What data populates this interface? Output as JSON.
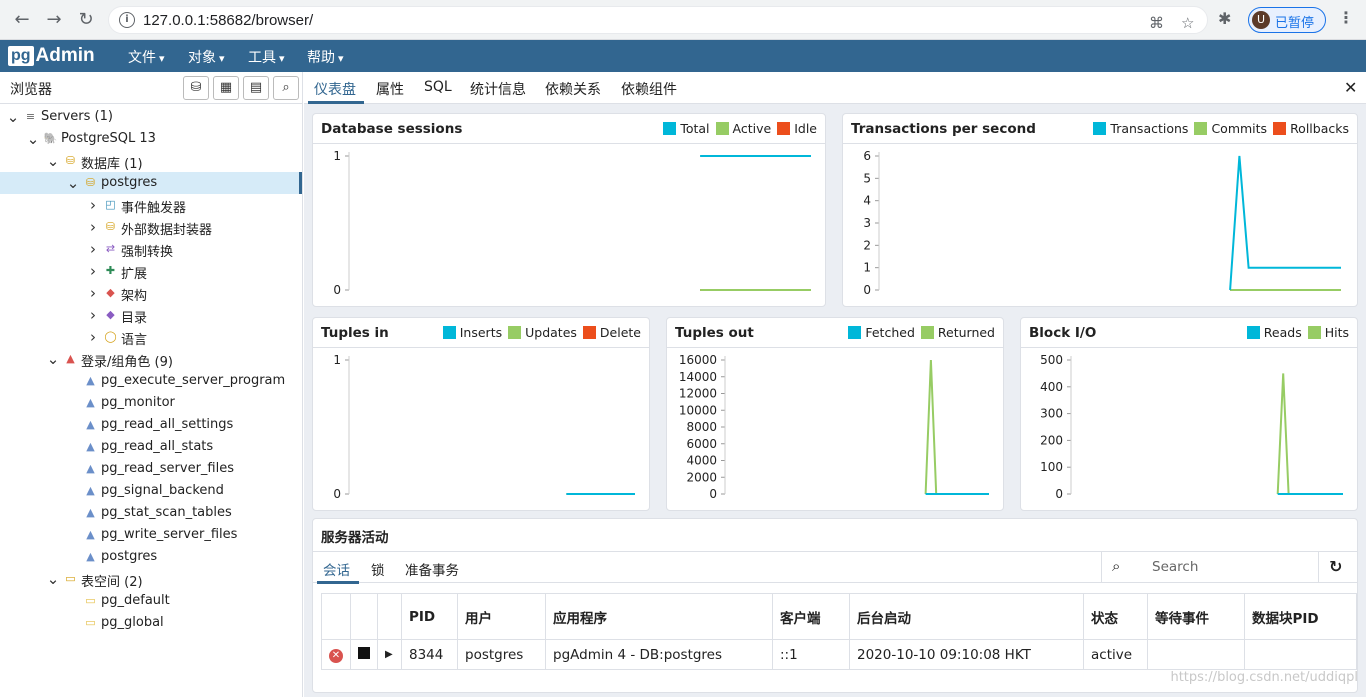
{
  "browser": {
    "url": "127.0.0.1:58682/browser/",
    "profile_initial": "U",
    "profile_label": "已暂停"
  },
  "navbar": {
    "logo_pg": "pg",
    "logo_admin": "Admin",
    "menus": [
      "文件",
      "对象",
      "工具",
      "帮助"
    ]
  },
  "left_panel": {
    "title": "浏览器",
    "tree": [
      {
        "label": "Servers (1)"
      },
      {
        "label": "PostgreSQL 13"
      },
      {
        "label": "数据库 (1)"
      },
      {
        "label": "postgres"
      },
      {
        "label": "事件触发器"
      },
      {
        "label": "外部数据封装器"
      },
      {
        "label": "强制转换"
      },
      {
        "label": "扩展"
      },
      {
        "label": "架构"
      },
      {
        "label": "目录"
      },
      {
        "label": "语言"
      },
      {
        "label": "登录/组角色 (9)"
      },
      {
        "label": "pg_execute_server_program"
      },
      {
        "label": "pg_monitor"
      },
      {
        "label": "pg_read_all_settings"
      },
      {
        "label": "pg_read_all_stats"
      },
      {
        "label": "pg_read_server_files"
      },
      {
        "label": "pg_signal_backend"
      },
      {
        "label": "pg_stat_scan_tables"
      },
      {
        "label": "pg_write_server_files"
      },
      {
        "label": "postgres"
      },
      {
        "label": "表空间 (2)"
      },
      {
        "label": "pg_default"
      },
      {
        "label": "pg_global"
      }
    ]
  },
  "tabs": [
    "仪表盘",
    "属性",
    "SQL",
    "统计信息",
    "依赖关系",
    "依赖组件"
  ],
  "colors": {
    "blue": "#00b7d9",
    "green": "#97cc64",
    "red": "#ec4e1c",
    "brand": "#326690"
  },
  "chart_data": [
    {
      "type": "line",
      "title": "Database sessions",
      "series": [
        {
          "name": "Total",
          "values": [
            1,
            1
          ]
        },
        {
          "name": "Active",
          "values": [
            0,
            0
          ]
        },
        {
          "name": "Idle",
          "values": [
            0,
            0
          ]
        }
      ],
      "yticks": [
        "1",
        "0"
      ],
      "ylim": [
        0,
        1
      ]
    },
    {
      "type": "line",
      "title": "Transactions per second",
      "series": [
        {
          "name": "Transactions",
          "values": [
            0,
            6,
            1,
            1,
            1
          ]
        },
        {
          "name": "Commits",
          "values": [
            0,
            0,
            0,
            0,
            0
          ]
        },
        {
          "name": "Rollbacks",
          "values": [
            0,
            0,
            0,
            0,
            0
          ]
        }
      ],
      "yticks": [
        "6",
        "5",
        "4",
        "3",
        "2",
        "1",
        "0"
      ],
      "ylim": [
        0,
        6
      ]
    },
    {
      "type": "line",
      "title": "Tuples in",
      "series": [
        {
          "name": "Inserts",
          "values": [
            0,
            0
          ]
        },
        {
          "name": "Updates",
          "values": [
            0,
            0
          ]
        },
        {
          "name": "Delete",
          "values": [
            0,
            0
          ]
        }
      ],
      "yticks": [
        "1",
        "0"
      ],
      "ylim": [
        0,
        1
      ]
    },
    {
      "type": "line",
      "title": "Tuples out",
      "series": [
        {
          "name": "Fetched",
          "values": [
            0,
            0,
            0,
            0
          ]
        },
        {
          "name": "Returned",
          "values": [
            0,
            16000,
            0,
            0
          ]
        }
      ],
      "yticks": [
        "16000",
        "14000",
        "12000",
        "10000",
        "8000",
        "6000",
        "4000",
        "2000",
        "0"
      ],
      "ylim": [
        0,
        16000
      ]
    },
    {
      "type": "line",
      "title": "Block I/O",
      "series": [
        {
          "name": "Reads",
          "values": [
            0,
            0,
            0,
            0
          ]
        },
        {
          "name": "Hits",
          "values": [
            0,
            450,
            0,
            0
          ]
        }
      ],
      "yticks": [
        "500",
        "400",
        "300",
        "200",
        "100",
        "0"
      ],
      "ylim": [
        0,
        500
      ]
    }
  ],
  "activity": {
    "title": "服务器活动",
    "tabs": [
      "会话",
      "锁",
      "准备事务"
    ],
    "search_placeholder": "Search",
    "columns": [
      "PID",
      "用户",
      "应用程序",
      "客户端",
      "后台启动",
      "状态",
      "等待事件",
      "数据块PID"
    ],
    "rows": [
      {
        "pid": "8344",
        "user": "postgres",
        "app": "pgAdmin 4 - DB:postgres",
        "client": "::1",
        "start": "2020-10-10 09:10:08 HKT",
        "state": "active",
        "wait": "",
        "blocking": ""
      }
    ]
  },
  "watermark": "https://blog.csdn.net/uddiqpl"
}
